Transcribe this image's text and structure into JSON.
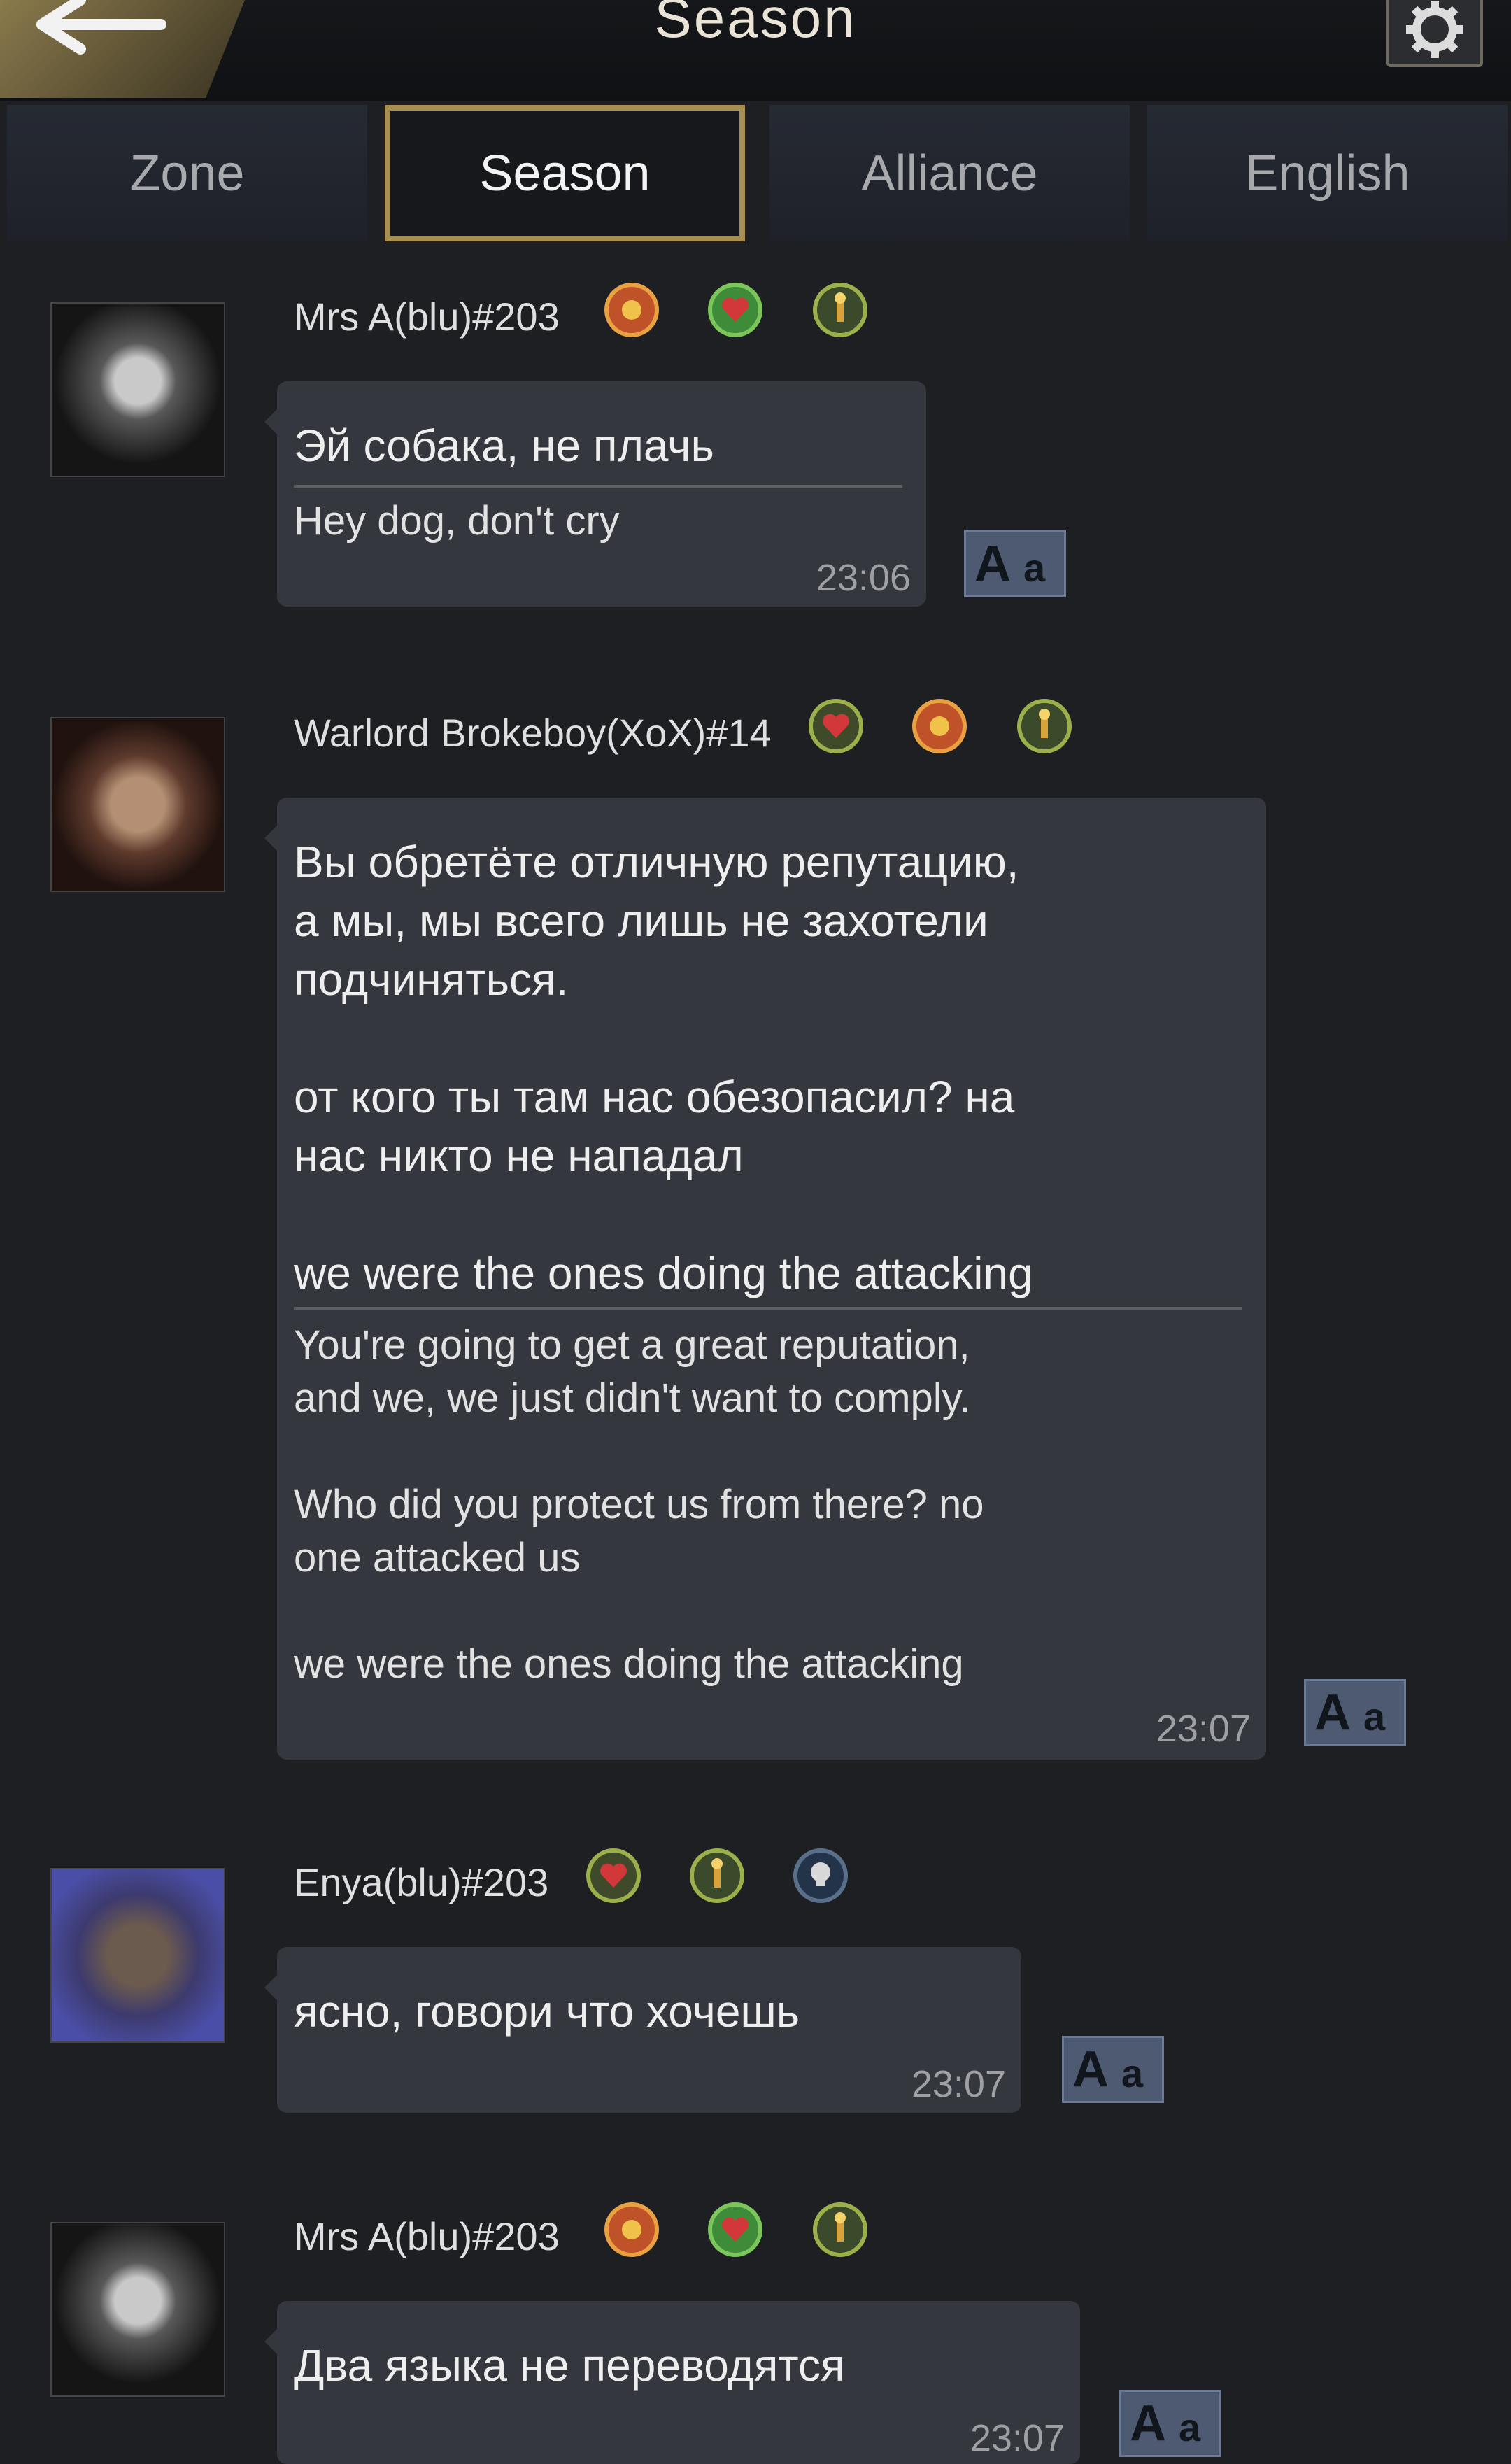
{
  "header": {
    "title": "Season",
    "back_icon": "back-arrow-icon",
    "settings_icon": "gear-icon"
  },
  "tabs": [
    {
      "label": "Zone",
      "active": false
    },
    {
      "label": "Season",
      "active": true
    },
    {
      "label": "Alliance",
      "active": false
    },
    {
      "label": "English",
      "active": false
    }
  ],
  "messages": [
    {
      "username": "Mrs A(blu)#203",
      "badges": [
        "orange-flame-badge",
        "green-heart-badge",
        "gold-torch-badge"
      ],
      "original": "Эй собака, не плачь",
      "translation": "Hey dog, don't cry",
      "time": "23:06"
    },
    {
      "username": "Warlord Brokeboy(XoX)#14",
      "badges": [
        "red-heart-badge",
        "orange-flame-badge",
        "gold-torch-badge"
      ],
      "original": "Вы обретёте отличную репутацию,\nа мы, мы всего лишь не захотели\nподчиняться.\n\nот кого ты там нас обезопасил? на\nнас никто не нападал\n\nwe were the ones doing the attacking",
      "translation": "You're going to get a great reputation,\nand we, we just didn't want to comply.\n\nWho did you protect us from there? no\none attacked us\n\nwe were the ones doing the attacking",
      "time": "23:07"
    },
    {
      "username": "Enya(blu)#203",
      "badges": [
        "red-heart-badge",
        "gold-torch-badge",
        "skull-badge"
      ],
      "original": "ясно, говори что хочешь",
      "time": "23:07"
    },
    {
      "username": "Mrs A(blu)#203",
      "badges": [
        "orange-flame-badge",
        "green-heart-badge",
        "gold-torch-badge"
      ],
      "original": "Два языка не переводятся",
      "time": "23:07"
    }
  ],
  "translate_button": {
    "big": "A",
    "small": "a",
    "icon": "translate-icon"
  },
  "colors": {
    "accent": "#a88e52",
    "bubble": "#34373d",
    "background": "#1d1f23"
  }
}
